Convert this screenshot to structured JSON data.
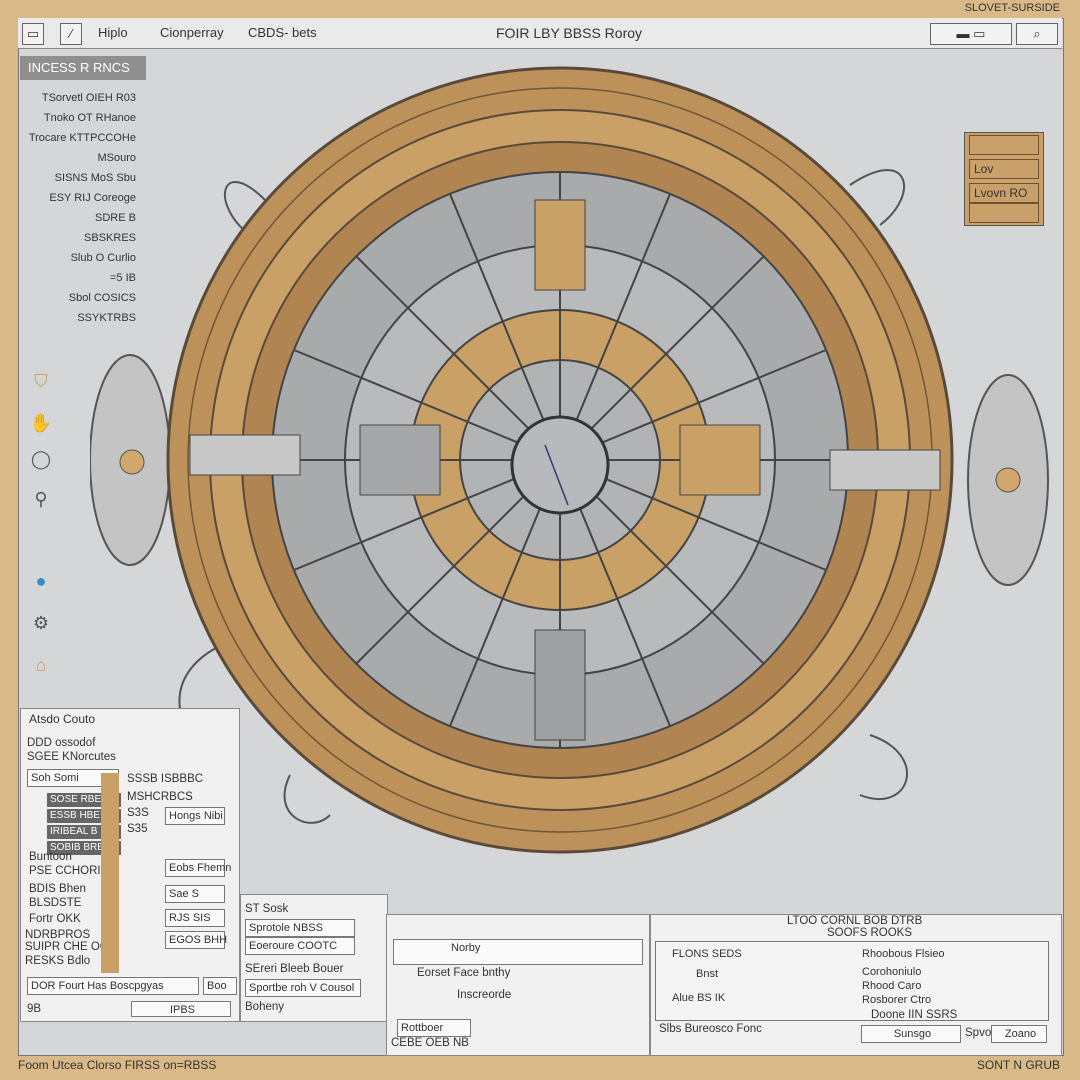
{
  "corner_label": "SLOVET-SURSIDE",
  "toolbar": {
    "menu1": "Hiplo",
    "menu2": "Cionperray",
    "menu3": "CBDS- bets",
    "title": "FOIR LBY BBSS Roroy",
    "search_symbol": "⌕"
  },
  "sidebar": {
    "tag": "INCESS R RNCS",
    "items": [
      "TSorvetl OIEH R03",
      "Tnoko OT RHanoe",
      "Trocare KTTPCCOHe",
      "MSouro",
      "SISNS MoS Sbu",
      "ESY RIJ Coreoge",
      "SDRE B",
      "SBSKRES",
      "Slub O Curlio",
      "=5 IB",
      "Sbol COSICS",
      "SSYKTRBS"
    ]
  },
  "legend": {
    "rows": [
      "",
      "Lov",
      "Lvovn RO",
      ""
    ]
  },
  "left_panel": {
    "title": "Atsdo Couto",
    "line1": "DDD ossodof",
    "line2": "SGEE KNorcutes",
    "tab": "Soh Somi",
    "dark_rows": [
      "SOSE RBE",
      "ESSB HBE",
      "IRIBEAL B",
      "SOBIB BRB"
    ],
    "list": [
      "Buntoon",
      "PSE CCHORI",
      "BDIS Bhen",
      "BLSDSTE",
      "Fortr OKK",
      "NDRBPROS",
      "SUIPR CHE OC",
      "RESKS Bdlo"
    ],
    "col_texts": [
      "SSSB ISBBBC",
      "MSHCRBCS",
      "S3S",
      "S35",
      "Hongs Nibi",
      "Eobs Fhemn",
      "Sae S",
      "RJS SIS",
      "EGOS BHH"
    ],
    "footer_label": "DOR Fourt Has Boscpgyas",
    "footer_btn": "Boo",
    "bottom_btn": "IPBS",
    "bottom_icon": "9B"
  },
  "mid_panel": {
    "lines": [
      "ST Sosk",
      "Sprotole NBSS",
      "Eoeroure COOTC",
      "SEreri Bleeb Bouer",
      "Sportbe roh V Cousol",
      "Boheny"
    ]
  },
  "center_panel": {
    "items": [
      "Norby",
      "Eorset Face bnthy",
      "Inscreorde"
    ],
    "button": "Rottboer",
    "bottom": "CEBE OEB NB"
  },
  "right_panel": {
    "header": "LTOO CORNL BOB DTRB",
    "sub": "SOOFS ROOKS",
    "label": "FLONS SEDS",
    "sel": "Rhoobous Flsieo",
    "rows_left": [
      "Bnst",
      "Alue BS IK"
    ],
    "rows_right": [
      "Corohoniulo",
      "Rhood Caro",
      "Rosborer Ctro"
    ],
    "footer_left": "Slbs Bureosco Fonc",
    "footer_right": "Doone IIN SSRS",
    "footer_btn1": "Sunsgo",
    "footer_btn2": "Zoano",
    "footer_left_btn": "Spvotte"
  },
  "status": {
    "left": "Foom Utcea Clorso   FIRSS on=RBSS",
    "right": "SONT N GRUB"
  },
  "colors": {
    "accent_tan": "#c9a066",
    "frame_bg": "#d4d6d8",
    "border_tan": "#d9b988"
  }
}
